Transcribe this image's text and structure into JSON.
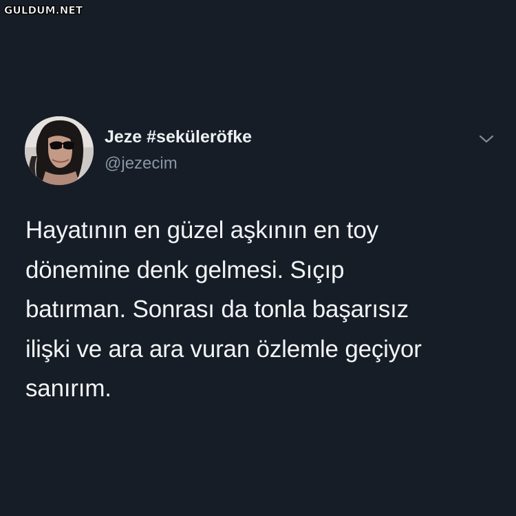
{
  "watermark": "GULDUM.NET",
  "tweet": {
    "display_name": "Jeze #seküleröfke",
    "handle": "@jezecim",
    "text": "Hayatının en güzel aşkının en toy\ndönemine denk gelmesi. Sıçıp\nbatırman. Sonrası da tonla başarısız\nilişki ve ara ara vuran özlemle geçiyor\nsanırım."
  },
  "icons": {
    "menu": "chevron-down-icon"
  },
  "colors": {
    "background": "#161d26",
    "text": "#f2f4f6",
    "secondary_text": "#8a96a3"
  }
}
